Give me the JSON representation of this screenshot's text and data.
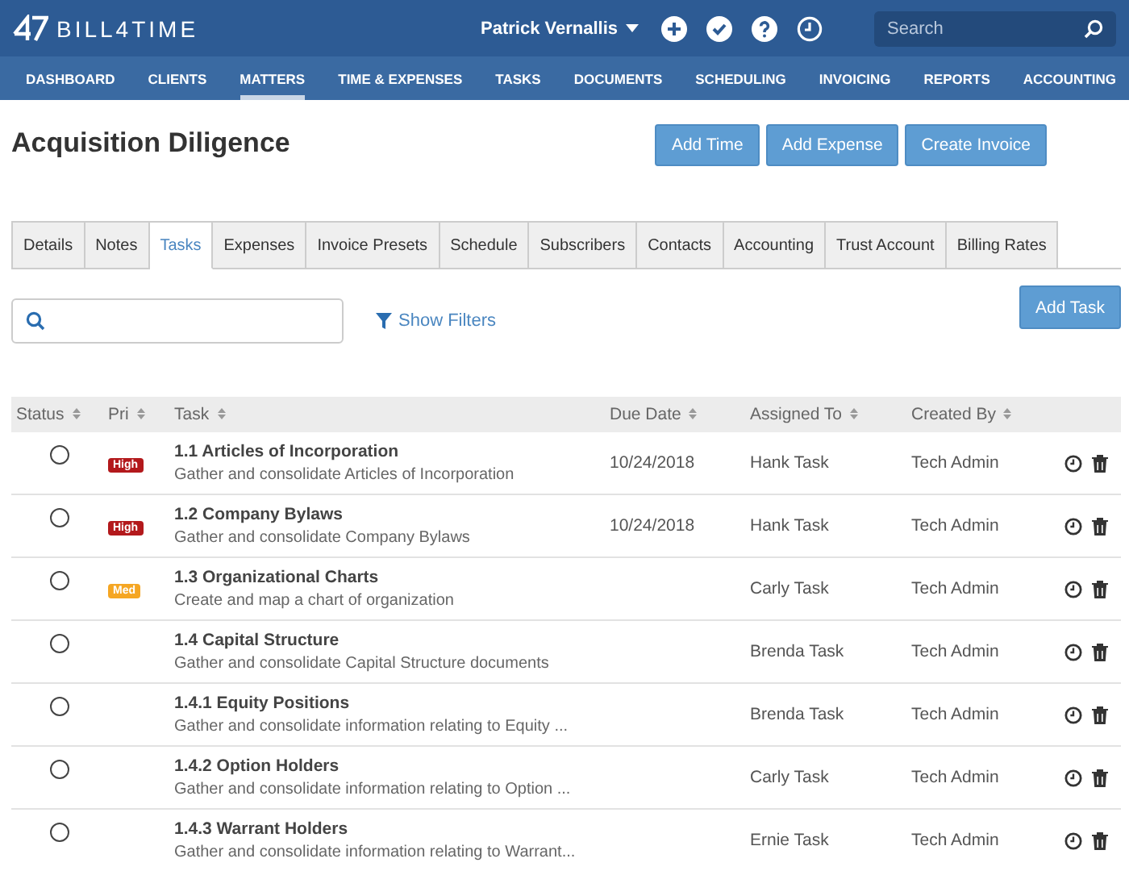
{
  "brand": {
    "name": "BILL4TIME"
  },
  "user": {
    "name": "Patrick Vernallis"
  },
  "search": {
    "placeholder": "Search"
  },
  "nav": [
    {
      "label": "DASHBOARD",
      "selected": false
    },
    {
      "label": "CLIENTS",
      "selected": false
    },
    {
      "label": "MATTERS",
      "selected": true
    },
    {
      "label": "TIME & EXPENSES",
      "selected": false
    },
    {
      "label": "TASKS",
      "selected": false
    },
    {
      "label": "DOCUMENTS",
      "selected": false
    },
    {
      "label": "SCHEDULING",
      "selected": false
    },
    {
      "label": "INVOICING",
      "selected": false
    },
    {
      "label": "REPORTS",
      "selected": false
    },
    {
      "label": "ACCOUNTING",
      "selected": false
    }
  ],
  "page_title": "Acquisition Diligence",
  "actions": [
    "Add Time",
    "Add Expense",
    "Create Invoice"
  ],
  "tabs": [
    {
      "label": "Details",
      "selected": false
    },
    {
      "label": "Notes",
      "selected": false
    },
    {
      "label": "Tasks",
      "selected": true
    },
    {
      "label": "Expenses",
      "selected": false
    },
    {
      "label": "Invoice Presets",
      "selected": false
    },
    {
      "label": "Schedule",
      "selected": false
    },
    {
      "label": "Subscribers",
      "selected": false
    },
    {
      "label": "Contacts",
      "selected": false
    },
    {
      "label": "Accounting",
      "selected": false
    },
    {
      "label": "Trust Account",
      "selected": false
    },
    {
      "label": "Billing Rates",
      "selected": false
    }
  ],
  "filters_link": "Show Filters",
  "add_task": "Add Task",
  "table": {
    "columns": [
      "Status",
      "Pri",
      "Task",
      "Due Date",
      "Assigned To",
      "Created By"
    ],
    "rows": [
      {
        "done": false,
        "priority": {
          "label": "High",
          "color": "#b3191c"
        },
        "title": "1.1 Articles of Incorporation",
        "description": "Gather and consolidate Articles of Incorporation",
        "due": "10/24/2018",
        "assigned": "Hank Task",
        "created": "Tech Admin"
      },
      {
        "done": false,
        "priority": {
          "label": "High",
          "color": "#b3191c"
        },
        "title": "1.2 Company Bylaws",
        "description": "Gather and consolidate Company Bylaws",
        "due": "10/24/2018",
        "assigned": "Hank Task",
        "created": "Tech Admin"
      },
      {
        "done": false,
        "priority": {
          "label": "Med",
          "color": "#f5a623"
        },
        "title": "1.3 Organizational Charts",
        "description": "Create and map a chart of organization",
        "assigned": "Carly Task",
        "created": "Tech Admin"
      },
      {
        "done": false,
        "title": "1.4 Capital Structure",
        "description": "Gather and consolidate Capital Structure documents",
        "assigned": "Brenda Task",
        "created": "Tech Admin"
      },
      {
        "done": false,
        "title": "1.4.1 Equity Positions",
        "description": "Gather and consolidate information relating to Equity ...",
        "assigned": "Brenda Task",
        "created": "Tech Admin"
      },
      {
        "done": false,
        "title": "1.4.2 Option Holders",
        "description": "Gather and consolidate information relating to Option ...",
        "assigned": "Carly Task",
        "created": "Tech Admin"
      },
      {
        "done": false,
        "title": "1.4.3 Warrant Holders",
        "description": "Gather and consolidate information relating to Warrant...",
        "assigned": "Ernie Task",
        "created": "Tech Admin"
      }
    ]
  }
}
